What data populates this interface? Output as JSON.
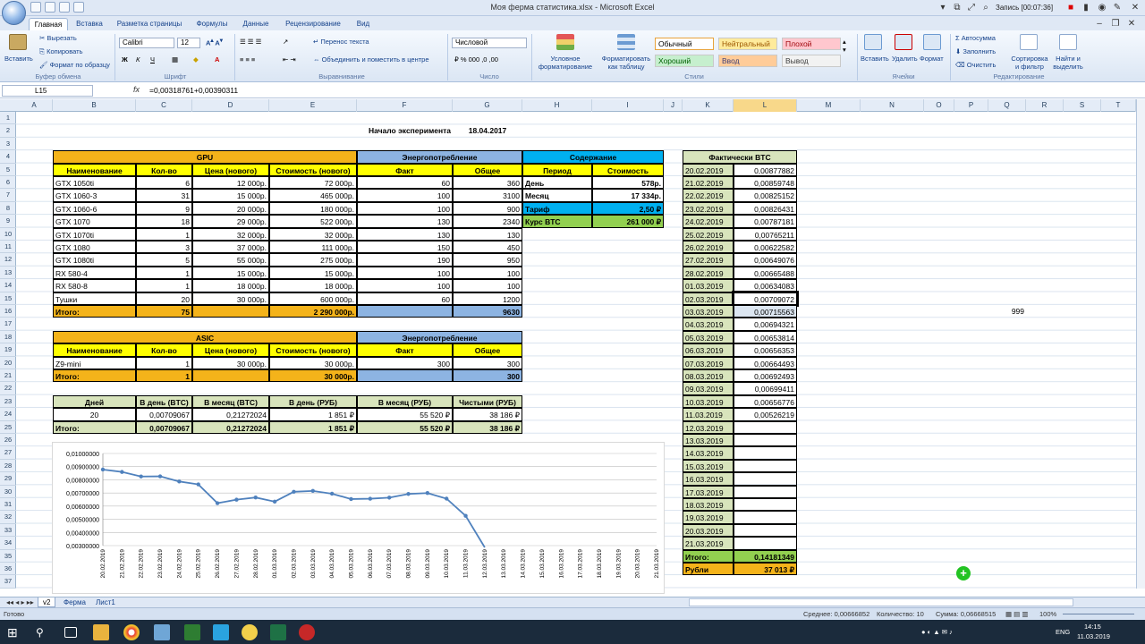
{
  "window": {
    "title": "Моя ферма статистика.xlsx - Microsoft Excel",
    "recording": "Запись [00:07:36]"
  },
  "tabs": [
    "Главная",
    "Вставка",
    "Разметка страницы",
    "Формулы",
    "Данные",
    "Рецензирование",
    "Вид"
  ],
  "ribbon": {
    "paste": "Вставить",
    "cut": "Вырезать",
    "copy": "Копировать",
    "format_painter": "Формат по образцу",
    "font_name": "Calibri",
    "font_size": "12",
    "wrap_text": "Перенос текста",
    "merge_center": "Объединить и поместить в центре",
    "number_format": "Числовой",
    "cond_format": "Условное форматирование",
    "format_table": "Форматировать как таблицу",
    "styles": [
      {
        "label": "Обычный",
        "bg": "#ffffff",
        "fg": "#000000"
      },
      {
        "label": "Нейтральный",
        "bg": "#ffeb9c",
        "fg": "#9c5700"
      },
      {
        "label": "Плохой",
        "bg": "#ffc7ce",
        "fg": "#9c0006"
      },
      {
        "label": "Хороший",
        "bg": "#c6efce",
        "fg": "#006100"
      },
      {
        "label": "Ввод",
        "bg": "#ffcc99",
        "fg": "#3f3f76"
      },
      {
        "label": "Вывод",
        "bg": "#f2f2f2",
        "fg": "#3f3f3f"
      }
    ],
    "insert": "Вставить",
    "delete": "Удалить",
    "format": "Формат",
    "autosum": "Автосумма",
    "fill": "Заполнить",
    "clear": "Очистить",
    "sort_filter": "Сортировка и фильтр",
    "find_select": "Найти и выделить",
    "groups": [
      "Буфер обмена",
      "Шрифт",
      "Выравнивание",
      "Число",
      "Стили",
      "Ячейки",
      "Редактирование"
    ]
  },
  "formula_bar": {
    "name_box": "L15",
    "fx": "fx",
    "formula": "=0,00318761+0,00390311"
  },
  "columns": [
    "A",
    "B",
    "C",
    "D",
    "E",
    "F",
    "G",
    "H",
    "I",
    "J",
    "K",
    "L",
    "M",
    "N",
    "O",
    "P",
    "Q",
    "R",
    "S",
    "T"
  ],
  "rows": [
    "1",
    "2",
    "3",
    "4",
    "5",
    "6",
    "7",
    "8",
    "9",
    "10",
    "11",
    "12",
    "13",
    "14",
    "15",
    "16",
    "17",
    "18",
    "19",
    "20",
    "21",
    "22",
    "23",
    "24",
    "25",
    "26",
    "27",
    "28",
    "29",
    "30",
    "31",
    "32",
    "33",
    "34",
    "35",
    "36",
    "37"
  ],
  "sheet": {
    "start_label": "Начало эксперимента",
    "start_date": "18.04.2017",
    "gpu_title": "GPU",
    "energy_title": "Энергопотребление",
    "content_title": "Содержание",
    "hdr": {
      "name": "Наименование",
      "qty": "Кол-во",
      "price": "Цена (нового)",
      "cost": "Стоимость (нового)",
      "fact": "Факт",
      "total": "Общее",
      "period": "Период",
      "cost2": "Стоимость"
    },
    "gpu_rows": [
      [
        "GTX 1050ti",
        "6",
        "12 000р.",
        "72 000р.",
        "60",
        "360"
      ],
      [
        "GTX 1060-3",
        "31",
        "15 000р.",
        "465 000р.",
        "100",
        "3100"
      ],
      [
        "GTX 1060-6",
        "9",
        "20 000р.",
        "180 000р.",
        "100",
        "900"
      ],
      [
        "GTX 1070",
        "18",
        "29 000р.",
        "522 000р.",
        "130",
        "2340"
      ],
      [
        "GTX 1070ti",
        "1",
        "32 000р.",
        "32 000р.",
        "130",
        "130"
      ],
      [
        "GTX 1080",
        "3",
        "37 000р.",
        "111 000р.",
        "150",
        "450"
      ],
      [
        "GTX 1080ti",
        "5",
        "55 000р.",
        "275 000р.",
        "190",
        "950"
      ],
      [
        "RX 580-4",
        "1",
        "15 000р.",
        "15 000р.",
        "100",
        "100"
      ],
      [
        "RX 580-8",
        "1",
        "18 000р.",
        "18 000р.",
        "100",
        "100"
      ],
      [
        "Тушки",
        "20",
        "30 000р.",
        "600 000р.",
        "60",
        "1200"
      ]
    ],
    "gpu_total": {
      "label": "Итого:",
      "qty": "75",
      "cost": "2 290 000р.",
      "energy": "9630"
    },
    "content_rows": [
      {
        "label": "День",
        "value": "578р."
      },
      {
        "label": "Месяц",
        "value": "17 334р."
      },
      {
        "label": "Тариф",
        "value": "2,50 ₽"
      },
      {
        "label": "Курс BTC",
        "value": "261 000 ₽"
      }
    ],
    "asic_title": "ASIC",
    "asic_row": [
      "Z9-mini",
      "1",
      "30 000р.",
      "30 000р.",
      "300",
      "300"
    ],
    "asic_total": {
      "label": "Итого:",
      "qty": "1",
      "cost": "30 000р.",
      "energy": "300"
    },
    "profit_hdr": [
      "Дней",
      "В день (BTC)",
      "В месяц (BTC)",
      "В день (РУБ)",
      "В месяц (РУБ)",
      "Чистыми (РУБ)"
    ],
    "profit_row": [
      "20",
      "0,00709067",
      "0,21272024",
      "1 851 ₽",
      "55 520 ₽",
      "38 186 ₽"
    ],
    "profit_total": [
      "Итого:",
      "0,00709067",
      "0,21272024",
      "1 851 ₽",
      "55 520 ₽",
      "38 186 ₽"
    ],
    "btc_title": "Фактически BTC",
    "btc_rows": [
      [
        "20.02.2019",
        "0,00877882"
      ],
      [
        "21.02.2019",
        "0,00859748"
      ],
      [
        "22.02.2019",
        "0,00825152"
      ],
      [
        "23.02.2019",
        "0,00826431"
      ],
      [
        "24.02.2019",
        "0,00787181"
      ],
      [
        "25.02.2019",
        "0,00765211"
      ],
      [
        "26.02.2019",
        "0,00622582"
      ],
      [
        "27.02.2019",
        "0,00649076"
      ],
      [
        "28.02.2019",
        "0,00665488"
      ],
      [
        "01.03.2019",
        "0,00634083"
      ],
      [
        "02.03.2019",
        "0,00709072"
      ],
      [
        "03.03.2019",
        "0,00715563"
      ],
      [
        "04.03.2019",
        "0,00694321"
      ],
      [
        "05.03.2019",
        "0,00653814"
      ],
      [
        "06.03.2019",
        "0,00656353"
      ],
      [
        "07.03.2019",
        "0,00664493"
      ],
      [
        "08.03.2019",
        "0,00692493"
      ],
      [
        "09.03.2019",
        "0,00699411"
      ],
      [
        "10.03.2019",
        "0,00656776"
      ],
      [
        "11.03.2019",
        "0,00526219"
      ],
      [
        "12.03.2019",
        ""
      ],
      [
        "13.03.2019",
        ""
      ],
      [
        "14.03.2019",
        ""
      ],
      [
        "15.03.2019",
        ""
      ],
      [
        "16.03.2019",
        ""
      ],
      [
        "17.03.2019",
        ""
      ],
      [
        "18.03.2019",
        ""
      ],
      [
        "19.03.2019",
        ""
      ],
      [
        "20.03.2019",
        ""
      ],
      [
        "21.03.2019",
        ""
      ]
    ],
    "btc_total": {
      "label": "Итого:",
      "value": "0,14181349"
    },
    "rub_total": {
      "label": "Рубли",
      "value": "37 013 ₽"
    },
    "q16": "999"
  },
  "chart_data": {
    "type": "line",
    "x": [
      "20.02.2019",
      "21.02.2019",
      "22.02.2019",
      "23.02.2019",
      "24.02.2019",
      "25.02.2019",
      "26.02.2019",
      "27.02.2019",
      "28.02.2019",
      "01.03.2019",
      "02.03.2019",
      "03.03.2019",
      "04.03.2019",
      "05.03.2019",
      "06.03.2019",
      "07.03.2019",
      "08.03.2019",
      "09.03.2019",
      "10.03.2019",
      "11.03.2019",
      "12.03.2019",
      "13.03.2019",
      "14.03.2019",
      "15.03.2019",
      "16.03.2019",
      "17.03.2019",
      "18.03.2019",
      "19.03.2019",
      "20.03.2019",
      "21.03.2019"
    ],
    "series": [
      {
        "values": [
          0.00877882,
          0.00859748,
          0.00825152,
          0.00826431,
          0.00787181,
          0.00765211,
          0.00622582,
          0.00649076,
          0.00665488,
          0.00634083,
          0.00709072,
          0.00715563,
          0.00694321,
          0.00653814,
          0.00656353,
          0.00664493,
          0.00692493,
          0.00699411,
          0.00656776,
          0.00526219,
          0
        ]
      }
    ],
    "yticks": [
      "0,01000000",
      "0,00900000",
      "0,00800000",
      "0,00700000",
      "0,00600000",
      "0,00500000",
      "0,00400000",
      "0,00300000"
    ],
    "ylim": [
      0.003,
      0.01
    ],
    "grid": true,
    "color": "#4f81bd"
  },
  "sheet_tabs": [
    "v2",
    "Ферма",
    "Лист1"
  ],
  "status": {
    "ready": "Готово",
    "average": "Среднее: 0,00666852",
    "count": "Количество: 10",
    "sum": "Сумма: 0,06668515",
    "zoom": "100%"
  },
  "taskbar": {
    "lang": "ENG",
    "time": "14:15",
    "date": "11.03.2019"
  }
}
